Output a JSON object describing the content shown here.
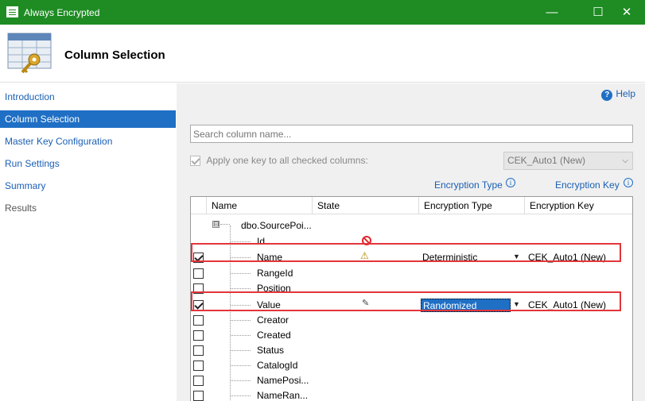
{
  "window": {
    "title": "Always Encrypted",
    "minimize": "—",
    "maximize": "☐",
    "close": "✕"
  },
  "header": {
    "title": "Column Selection"
  },
  "sidebar": {
    "items": [
      {
        "label": "Introduction",
        "state": "link"
      },
      {
        "label": "Column Selection",
        "state": "active"
      },
      {
        "label": "Master Key Configuration",
        "state": "link"
      },
      {
        "label": "Run Settings",
        "state": "link"
      },
      {
        "label": "Summary",
        "state": "link"
      },
      {
        "label": "Results",
        "state": "disabled"
      }
    ]
  },
  "help": {
    "label": "Help",
    "icon": "?"
  },
  "search": {
    "placeholder": "Search column name..."
  },
  "apply": {
    "label": "Apply one key to all checked columns:",
    "checked": true,
    "key_value": "CEK_Auto1 (New)"
  },
  "column_headers_above": {
    "encryption_type": "Encryption Type",
    "encryption_key": "Encryption Key",
    "info_icon": "i"
  },
  "grid": {
    "headers": {
      "name": "Name",
      "state": "State",
      "encryption_type": "Encryption Type",
      "encryption_key": "Encryption Key"
    },
    "table_node": {
      "label": "dbo.SourcePoi...",
      "expander": "⊟"
    },
    "rows": [
      {
        "name": "Id",
        "checked": false,
        "has_checkbox": false,
        "state_icon": "blocked-icon",
        "enc_type": "",
        "enc_key": ""
      },
      {
        "name": "Name",
        "checked": true,
        "has_checkbox": true,
        "state_icon": "warning-icon",
        "enc_type": "Deterministic",
        "enc_key": "CEK_Auto1 (New)"
      },
      {
        "name": "RangeId",
        "checked": false,
        "has_checkbox": true,
        "state_icon": "",
        "enc_type": "",
        "enc_key": ""
      },
      {
        "name": "Position",
        "checked": false,
        "has_checkbox": true,
        "state_icon": "",
        "enc_type": "",
        "enc_key": ""
      },
      {
        "name": "Value",
        "checked": true,
        "has_checkbox": true,
        "state_icon": "pencil-icon",
        "enc_type": "Randomized",
        "enc_key": "CEK_Auto1 (New)"
      },
      {
        "name": "Creator",
        "checked": false,
        "has_checkbox": true,
        "state_icon": "",
        "enc_type": "",
        "enc_key": ""
      },
      {
        "name": "Created",
        "checked": false,
        "has_checkbox": true,
        "state_icon": "",
        "enc_type": "",
        "enc_key": ""
      },
      {
        "name": "Status",
        "checked": false,
        "has_checkbox": true,
        "state_icon": "",
        "enc_type": "",
        "enc_key": ""
      },
      {
        "name": "CatalogId",
        "checked": false,
        "has_checkbox": true,
        "state_icon": "",
        "enc_type": "",
        "enc_key": ""
      },
      {
        "name": "NamePosi...",
        "checked": false,
        "has_checkbox": true,
        "state_icon": "",
        "enc_type": "",
        "enc_key": ""
      },
      {
        "name": "NameRan...",
        "checked": false,
        "has_checkbox": true,
        "state_icon": "",
        "enc_type": "",
        "enc_key": ""
      }
    ]
  },
  "colors": {
    "titlebar": "#1e8c23",
    "accent": "#1f6fc5",
    "highlight": "#e3353b"
  }
}
